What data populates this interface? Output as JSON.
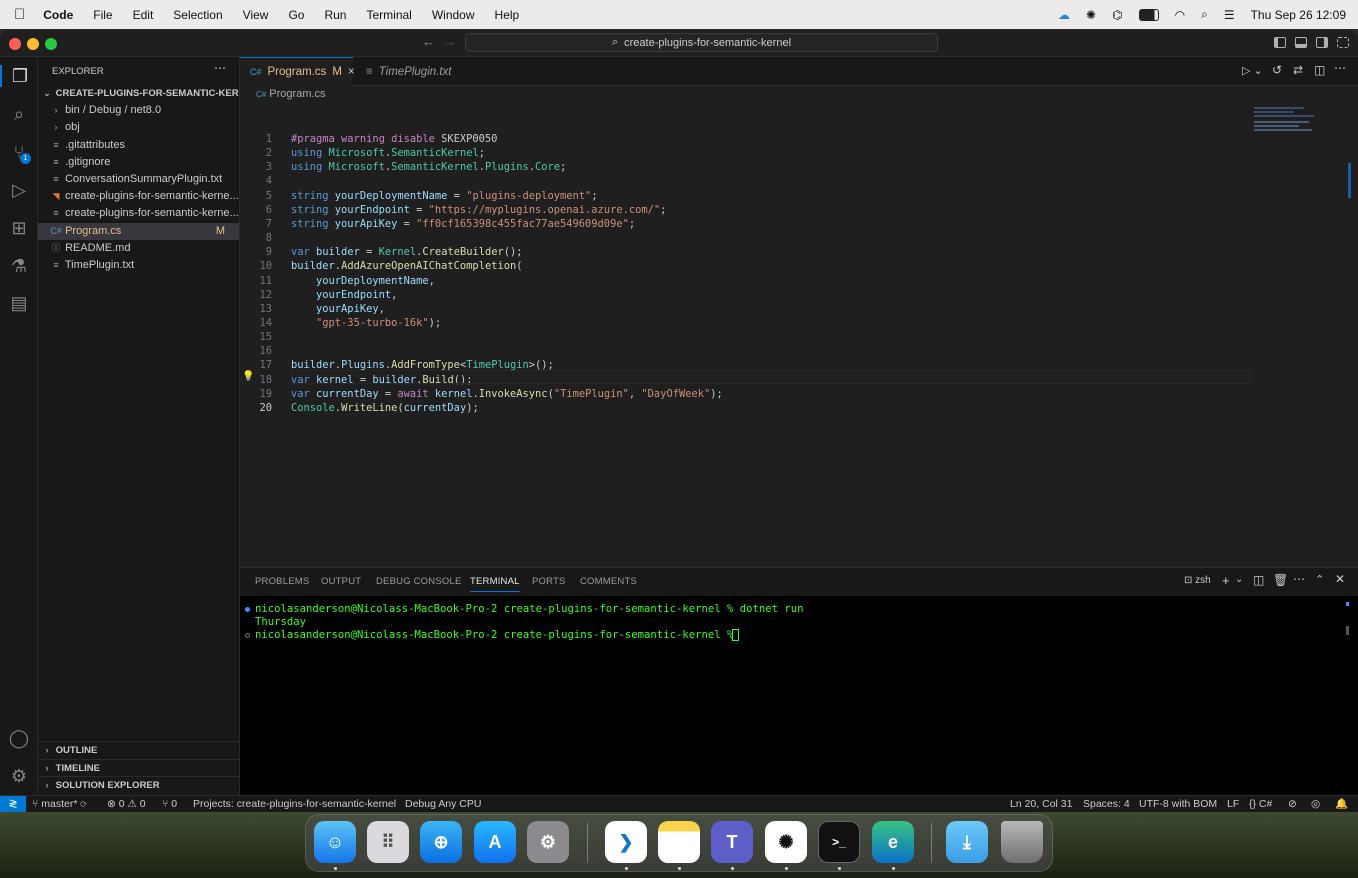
{
  "menubar": {
    "app": "Code",
    "items": [
      "File",
      "Edit",
      "Selection",
      "View",
      "Go",
      "Run",
      "Terminal",
      "Window",
      "Help"
    ],
    "datetime": "Thu Sep 26  12:09"
  },
  "titlebar": {
    "search": "create-plugins-for-semantic-kernel"
  },
  "explorer": {
    "header": "EXPLORER",
    "root": "CREATE-PLUGINS-FOR-SEMANTIC-KER...",
    "items": [
      {
        "label": "bin / Debug / net8.0",
        "kind": "folder",
        "badge": ""
      },
      {
        "label": "obj",
        "kind": "folder",
        "badge": ""
      },
      {
        "label": ".gitattributes",
        "kind": "file",
        "badge": ""
      },
      {
        "label": ".gitignore",
        "kind": "file",
        "badge": ""
      },
      {
        "label": "ConversationSummaryPlugin.txt",
        "kind": "file",
        "badge": ""
      },
      {
        "label": "create-plugins-for-semantic-kerne...",
        "kind": "rss",
        "badge": ""
      },
      {
        "label": "create-plugins-for-semantic-kerne...",
        "kind": "file",
        "badge": ""
      },
      {
        "label": "Program.cs",
        "kind": "cs",
        "badge": "M"
      },
      {
        "label": "README.md",
        "kind": "file",
        "badge": ""
      },
      {
        "label": "TimePlugin.txt",
        "kind": "file",
        "badge": ""
      }
    ],
    "sections": [
      "OUTLINE",
      "TIMELINE",
      "SOLUTION EXPLORER"
    ]
  },
  "tabs": [
    {
      "label": "Program.cs",
      "badge": "M",
      "close": "×"
    },
    {
      "label": "TimePlugin.txt"
    }
  ],
  "breadcrumb": "Program.cs",
  "editor": {
    "lines": [
      [
        [
          "pp",
          "#pragma warning disable "
        ],
        [
          "d",
          "SKEXP0050"
        ]
      ],
      [
        [
          "k",
          "using "
        ],
        [
          "t",
          "Microsoft"
        ],
        [
          "d",
          "."
        ],
        [
          "t",
          "SemanticKernel"
        ],
        [
          "d",
          ";"
        ]
      ],
      [
        [
          "k",
          "using "
        ],
        [
          "t",
          "Microsoft"
        ],
        [
          "d",
          "."
        ],
        [
          "t",
          "SemanticKernel"
        ],
        [
          "d",
          "."
        ],
        [
          "t",
          "Plugins"
        ],
        [
          "d",
          "."
        ],
        [
          "t",
          "Core"
        ],
        [
          "d",
          ";"
        ]
      ],
      [],
      [
        [
          "k",
          "string "
        ],
        [
          "v",
          "yourDeploymentName"
        ],
        [
          "d",
          " = "
        ],
        [
          "s",
          "\"plugins-deployment\""
        ],
        [
          "d",
          ";"
        ]
      ],
      [
        [
          "k",
          "string "
        ],
        [
          "v",
          "yourEndpoint"
        ],
        [
          "d",
          " = "
        ],
        [
          "s",
          "\"https://myplugins.openai.azure.com/\""
        ],
        [
          "d",
          ";"
        ]
      ],
      [
        [
          "k",
          "string "
        ],
        [
          "v",
          "yourApiKey"
        ],
        [
          "d",
          " = "
        ],
        [
          "s",
          "\"ff0cf165398c455fac77ae549609d09e\""
        ],
        [
          "d",
          ";"
        ]
      ],
      [],
      [
        [
          "k",
          "var "
        ],
        [
          "v",
          "builder"
        ],
        [
          "d",
          " = "
        ],
        [
          "t",
          "Kernel"
        ],
        [
          "d",
          "."
        ],
        [
          "f",
          "CreateBuilder"
        ],
        [
          "d",
          "();"
        ]
      ],
      [
        [
          "v",
          "builder"
        ],
        [
          "d",
          "."
        ],
        [
          "f",
          "AddAzureOpenAIChatCompletion"
        ],
        [
          "d",
          "("
        ]
      ],
      [
        [
          "d",
          "    "
        ],
        [
          "v",
          "yourDeploymentName"
        ],
        [
          "d",
          ","
        ]
      ],
      [
        [
          "d",
          "    "
        ],
        [
          "v",
          "yourEndpoint"
        ],
        [
          "d",
          ","
        ]
      ],
      [
        [
          "d",
          "    "
        ],
        [
          "v",
          "yourApiKey"
        ],
        [
          "d",
          ","
        ]
      ],
      [
        [
          "d",
          "    "
        ],
        [
          "s",
          "\"gpt-35-turbo-16k\""
        ],
        [
          "d",
          ");"
        ]
      ],
      [],
      [],
      [
        [
          "v",
          "builder"
        ],
        [
          "d",
          "."
        ],
        [
          "v",
          "Plugins"
        ],
        [
          "d",
          "."
        ],
        [
          "f",
          "AddFromType"
        ],
        [
          "d",
          "<"
        ],
        [
          "t",
          "TimePlugin"
        ],
        [
          "d",
          ">();"
        ]
      ],
      [
        [
          "k",
          "var "
        ],
        [
          "v",
          "kernel"
        ],
        [
          "d",
          " = "
        ],
        [
          "v",
          "builder"
        ],
        [
          "d",
          "."
        ],
        [
          "f",
          "Build"
        ],
        [
          "d",
          "();"
        ]
      ],
      [
        [
          "k",
          "var "
        ],
        [
          "v",
          "currentDay"
        ],
        [
          "d",
          " = "
        ],
        [
          "pp",
          "await "
        ],
        [
          "v",
          "kernel"
        ],
        [
          "d",
          "."
        ],
        [
          "f",
          "InvokeAsync"
        ],
        [
          "d",
          "("
        ],
        [
          "s",
          "\"TimePlugin\""
        ],
        [
          "d",
          ", "
        ],
        [
          "s",
          "\"DayOfWeek\""
        ],
        [
          "d",
          ");"
        ]
      ],
      [
        [
          "t",
          "Console"
        ],
        [
          "d",
          "."
        ],
        [
          "f",
          "WriteLine"
        ],
        [
          "d",
          "("
        ],
        [
          "v",
          "currentDay"
        ],
        [
          "d",
          ");"
        ]
      ]
    ]
  },
  "panel": {
    "tabs": [
      "PROBLEMS",
      "OUTPUT",
      "DEBUG CONSOLE",
      "TERMINAL",
      "PORTS",
      "COMMENTS"
    ],
    "shell": "zsh",
    "terminal": [
      "nicolasanderson@Nicolass-MacBook-Pro-2 create-plugins-for-semantic-kernel % dotnet run",
      "Thursday",
      "nicolasanderson@Nicolass-MacBook-Pro-2 create-plugins-for-semantic-kernel % "
    ]
  },
  "status": {
    "branch": "master*",
    "problems": "⊗ 0 ⚠ 0",
    "ports": "⑂ 0",
    "project": "Projects: create-plugins-for-semantic-kernel",
    "debug": "Debug Any CPU",
    "position": "Ln 20, Col 31",
    "spaces": "Spaces: 4",
    "encoding": "UTF-8 with BOM",
    "eol": "LF",
    "lang": "{} C#",
    "scm_badge": "1"
  },
  "colors": {
    "accent": "#0078d4",
    "terminal_text": "#39ff14",
    "modified": "#e2c08d"
  }
}
